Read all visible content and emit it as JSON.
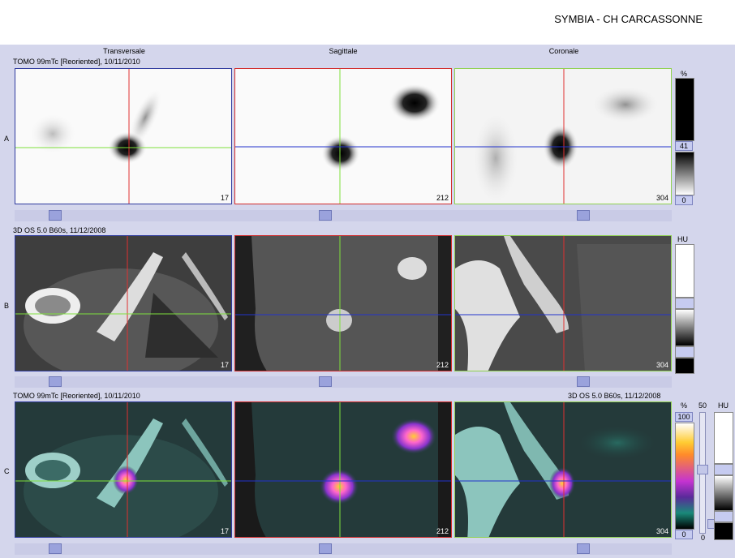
{
  "header": {
    "title": "SYMBIA - CH CARCASSONNE"
  },
  "columns": [
    "Transversale",
    "Sagittale",
    "Coronale"
  ],
  "rows": {
    "A": {
      "label": "A",
      "series_left": "TOMO 99mTc [Reoriented], 10/11/2010",
      "series_right": "",
      "slices": [
        "17",
        "212",
        "304"
      ]
    },
    "B": {
      "label": "B",
      "series_left": "3D  OS  5.0  B60s, 11/12/2008",
      "series_right": "",
      "slices": [
        "17",
        "212",
        "304"
      ]
    },
    "C": {
      "label": "C",
      "series_left": "TOMO 99mTc [Reoriented], 10/11/2010",
      "series_right": "3D  OS  5.0  B60s, 11/12/2008",
      "slices": [
        "17",
        "212",
        "304"
      ]
    }
  },
  "colorbars": {
    "A": {
      "unit": "%",
      "value": "41",
      "min": "0"
    },
    "B": {
      "unit": "HU"
    },
    "C": {
      "unit": "%",
      "max": "100",
      "min": "0",
      "fusion_level": "50",
      "fusion_min": "0",
      "ct_unit": "HU"
    }
  },
  "colors": {
    "blue_frame": "#2e3a9e",
    "red_frame": "#d22a2a",
    "green_frame": "#8fd14f",
    "crosshair_red": "#e03030",
    "crosshair_green": "#7ee03c",
    "crosshair_blue": "#2233cc",
    "background": "#d4d6ec"
  }
}
